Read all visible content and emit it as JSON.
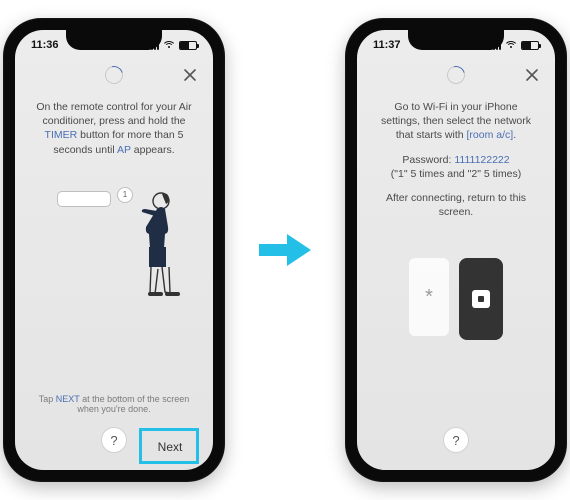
{
  "accent": "#24bfe6",
  "link": "#4b6fb3",
  "left": {
    "status": {
      "time": "11:36"
    },
    "close_label": "×",
    "instruction": {
      "pre": "On the remote control for your Air conditioner, press and hold the ",
      "hl1": "TIMER",
      "mid": " button for more than 5 seconds until ",
      "hl2": "AP",
      "post": " appears."
    },
    "callout_value": "1",
    "tap_note": {
      "pre": "Tap ",
      "hl": "NEXT",
      "post": " at the bottom of the screen when you're done."
    },
    "help_label": "?",
    "next_label": "Next"
  },
  "right": {
    "status": {
      "time": "11:37"
    },
    "close_label": "×",
    "instruction": {
      "pre": "Go to Wi-Fi in your iPhone settings, then select the network that starts with ",
      "hl": "[room a/c]",
      "post": "."
    },
    "password_label": "Password: ",
    "password_value": "1111122222",
    "password_hint": "(\"1\" 5 times and \"2\" 5 times)",
    "after": "After connecting, return to this screen.",
    "asterisk": "*",
    "help_label": "?"
  }
}
